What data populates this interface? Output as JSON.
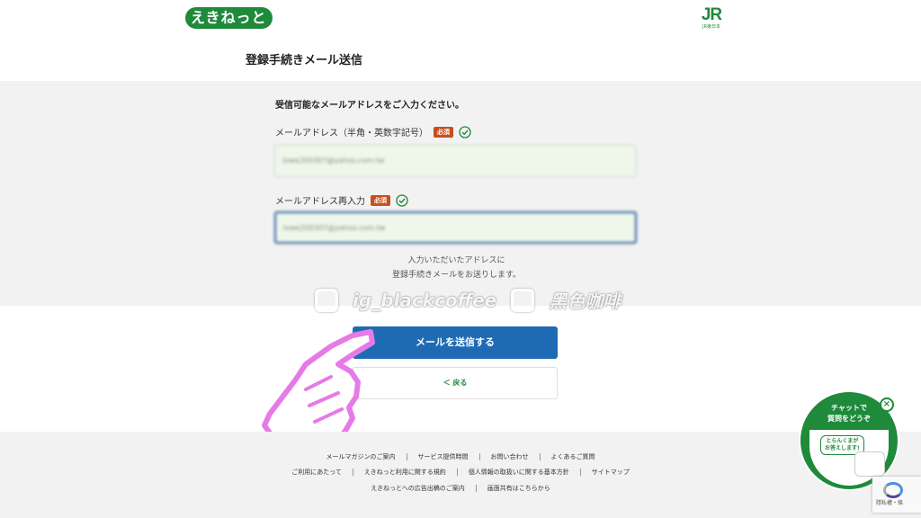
{
  "header": {
    "logo_text": "えきねっと",
    "jr_logo_text": "JR",
    "jr_logo_sub": "JR東日本",
    "page_title": "登録手続きメール送信"
  },
  "form": {
    "intro": "受信可能なメールアドレスをご入力ください。",
    "email": {
      "label": "メールアドレス（半角・英数字記号）",
      "required_badge": "必須",
      "value": "lowe200307@yahoo.com.tw"
    },
    "email_confirm": {
      "label": "メールアドレス再入力",
      "required_badge": "必須",
      "value": "lowe200307@yahoo.com.tw"
    },
    "note_line1": "入力いただいたアドレスに",
    "note_line2": "登録手続きメールをお送りします。",
    "submit_label": "メールを送信する",
    "back_label": "＜ 戻る"
  },
  "watermark": {
    "left": "ig_blackcoffee",
    "right": "黑色咖啡"
  },
  "footer": {
    "row1": [
      "メールマガジンのご案内",
      "サービス提供時間",
      "お問い合わせ",
      "よくあるご質問"
    ],
    "row2": [
      "ご利用にあたって",
      "えきねっと利用に関する規約",
      "個人情報の取扱いに関する基本方針",
      "サイトマップ"
    ],
    "row3": [
      "えきねっとへの広告出稿のご案内",
      "画面共有はこちらから"
    ]
  },
  "chat": {
    "title_line1": "チャットで",
    "title_line2": "質問をどうぞ",
    "bubble_line1": "とらんくまが",
    "bubble_line2": "お答えします!",
    "close_glyph": "×"
  },
  "recaptcha": {
    "text": "隱私權・條"
  },
  "colors": {
    "brand_green": "#1e8a3a",
    "primary_blue": "#1f6bb3",
    "required_orange": "#c5501e",
    "input_bg": "#eef7ea"
  }
}
